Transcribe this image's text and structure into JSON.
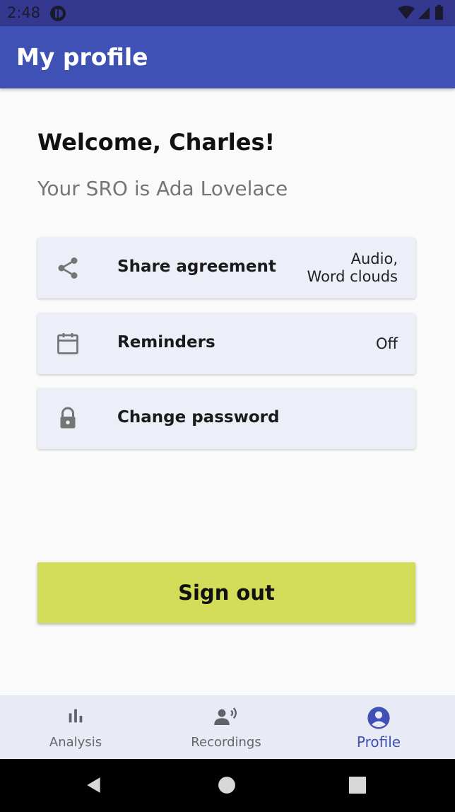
{
  "status_bar": {
    "time": "2:48"
  },
  "app_bar": {
    "title": "My profile"
  },
  "welcome": {
    "heading": "Welcome, Charles!",
    "sro_text": "Your SRO is Ada Lovelace"
  },
  "settings": [
    {
      "icon": "share-icon",
      "label": "Share agreement",
      "value": "Audio,\nWord clouds"
    },
    {
      "icon": "calendar-icon",
      "label": "Reminders",
      "value": "Off"
    },
    {
      "icon": "lock-icon",
      "label": "Change password",
      "value": ""
    }
  ],
  "sign_out_label": "Sign out",
  "bottom_nav": [
    {
      "icon": "bar-chart-icon",
      "label": "Analysis",
      "active": false
    },
    {
      "icon": "voice-icon",
      "label": "Recordings",
      "active": false
    },
    {
      "icon": "account-circle-icon",
      "label": "Profile",
      "active": true
    }
  ],
  "colors": {
    "status_bar": "#34398f",
    "app_bar": "#3f51b5",
    "card": "#eceef8",
    "sign_out": "#d4dd5a",
    "nav_active": "#3f51b5"
  }
}
